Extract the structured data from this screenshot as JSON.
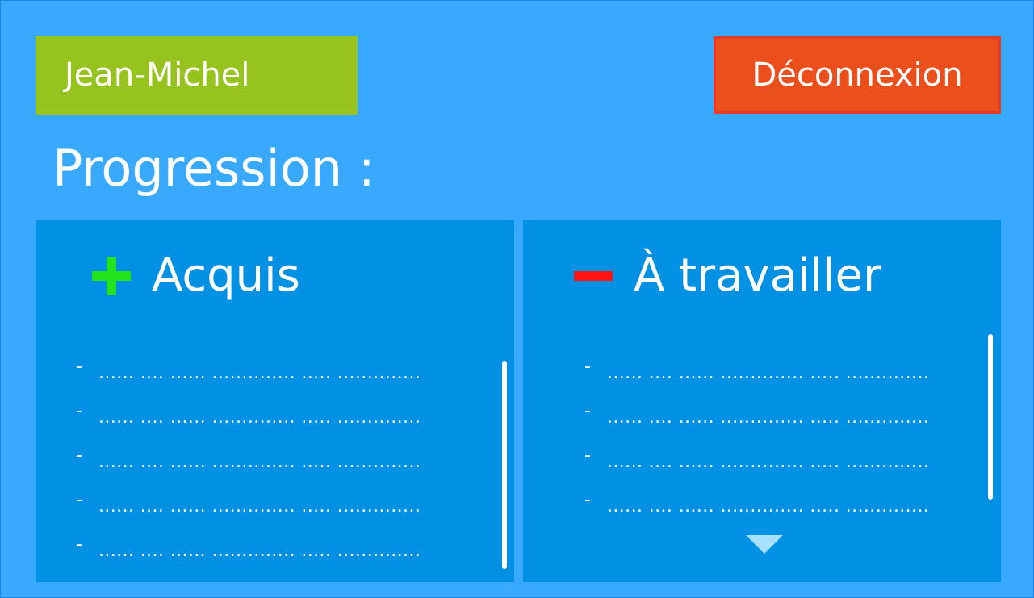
{
  "header": {
    "user_name": "Jean-Michel",
    "logout_label": "Déconnexion"
  },
  "main": {
    "title": "Progression :"
  },
  "panels": {
    "acquired": {
      "title": "Acquis",
      "icon": "plus-icon",
      "items": [
        "...... .... ...... .............. ..... ..............",
        "...... .... ...... .............. ..... ..............",
        "...... .... ...... .............. ..... ..............",
        "...... .... ...... .............. ..... ..............",
        "...... .... ...... .............. ..... .............."
      ]
    },
    "to_work": {
      "title": "À travailler",
      "icon": "minus-icon",
      "items": [
        "...... .... ...... .............. ..... ..............",
        "...... .... ...... .............. ..... ..............",
        "...... .... ...... .............. ..... ..............",
        "...... .... ...... .............. ..... .............."
      ]
    }
  },
  "colors": {
    "background": "#39a8ff",
    "panel": "#0090e4",
    "user_badge": "#97c31f",
    "logout": "#ea4f1c",
    "plus": "#24e31c",
    "minus": "#ff1414"
  }
}
